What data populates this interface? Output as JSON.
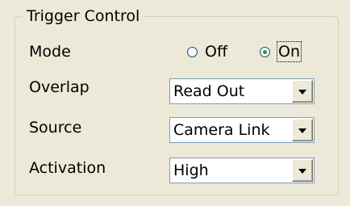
{
  "group": {
    "title": "Trigger Control"
  },
  "mode": {
    "label": "Mode",
    "options": [
      {
        "label": "Off",
        "selected": false
      },
      {
        "label": "On",
        "selected": true
      }
    ]
  },
  "overlap": {
    "label": "Overlap",
    "value": "Read Out"
  },
  "source": {
    "label": "Source",
    "value": "Camera Link"
  },
  "activation": {
    "label": "Activation",
    "value": "High"
  },
  "icons": {
    "dropdown": "chevron-down-icon"
  },
  "colors": {
    "background": "#ECE9D8",
    "radio_dot": "#21A121",
    "field_border": "#7F9DB9"
  }
}
